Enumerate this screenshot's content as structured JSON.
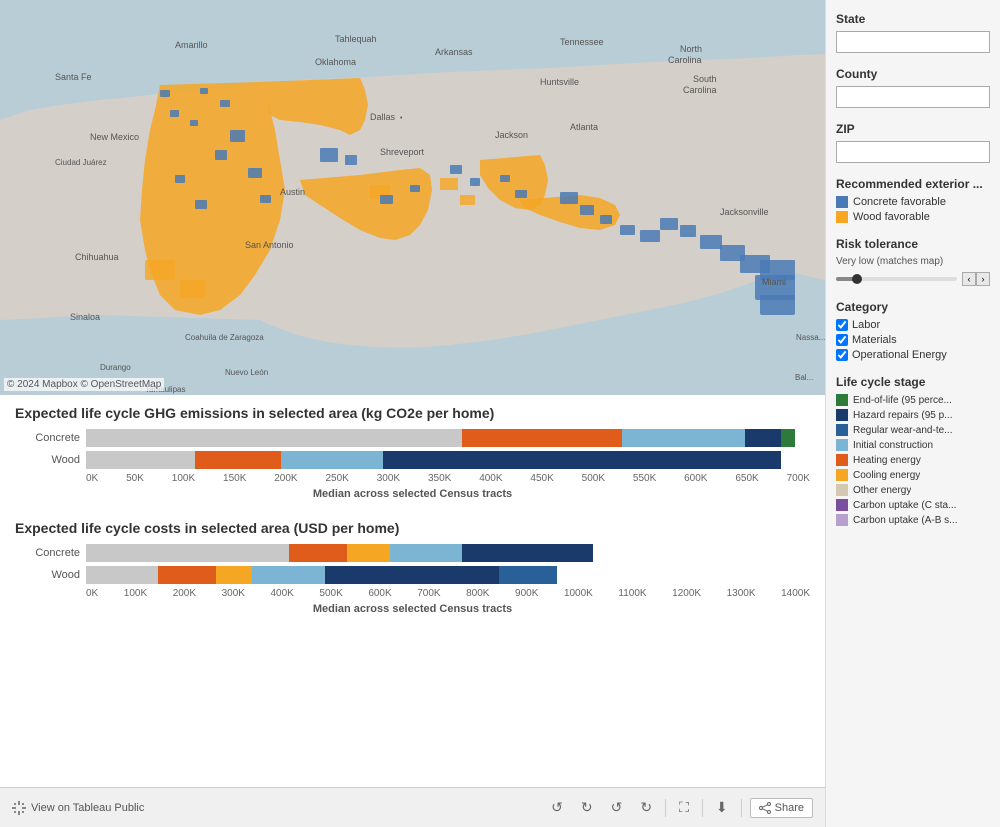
{
  "state_label": "State",
  "county_label": "County",
  "zip_label": "ZIP",
  "recommended_label": "Recommended exterior ...",
  "concrete_label": "Concrete favorable",
  "wood_label": "Wood favorable",
  "risk_tolerance_label": "Risk tolerance",
  "risk_value": "Very low (matches map)",
  "category_label": "Category",
  "labor_label": "Labor",
  "materials_label": "Materials",
  "operational_energy_label": "Operational Energy",
  "lifecycle_stage_label": "Life cycle stage",
  "lifecycle_items": [
    {
      "color": "#2d7a3a",
      "label": "End-of-life (95 perce..."
    },
    {
      "color": "#1a3a6b",
      "label": "Hazard repairs (95 p..."
    },
    {
      "color": "#2a6098",
      "label": "Regular wear-and-te..."
    },
    {
      "color": "#7cb4d4",
      "label": "Initial construction"
    },
    {
      "color": "#e05c1a",
      "label": "Heating energy"
    },
    {
      "color": "#f5a623",
      "label": "Cooling energy"
    },
    {
      "color": "#d4c9b0",
      "label": "Other energy"
    },
    {
      "color": "#7b4f9e",
      "label": "Carbon uptake (C sta..."
    },
    {
      "color": "#b8a0cc",
      "label": "Carbon uptake (A-B s..."
    }
  ],
  "ghg_title": "Expected life cycle GHG emissions in selected area (kg CO2e per home)",
  "ghg_subtitle": "Median across selected Census tracts",
  "ghg_x_labels": [
    "0K",
    "50K",
    "100K",
    "150K",
    "200K",
    "250K",
    "300K",
    "350K",
    "400K",
    "450K",
    "500K",
    "550K",
    "600K",
    "650K",
    "700K"
  ],
  "cost_title": "Expected life cycle costs in selected area (USD per home)",
  "cost_subtitle": "Median across selected Census tracts",
  "cost_x_labels": [
    "0K",
    "100K",
    "200K",
    "300K",
    "400K",
    "500K",
    "600K",
    "700K",
    "800K",
    "900K",
    "1000K",
    "1100K",
    "1200K",
    "1300K",
    "1400K"
  ],
  "concrete_label_bar": "Concrete",
  "wood_label_bar": "Wood",
  "map_copyright": "© 2024 Mapbox  © OpenStreetMap",
  "nc_text": "North Carolina",
  "view_tableau": "View on Tableau Public",
  "share_label": "Share"
}
